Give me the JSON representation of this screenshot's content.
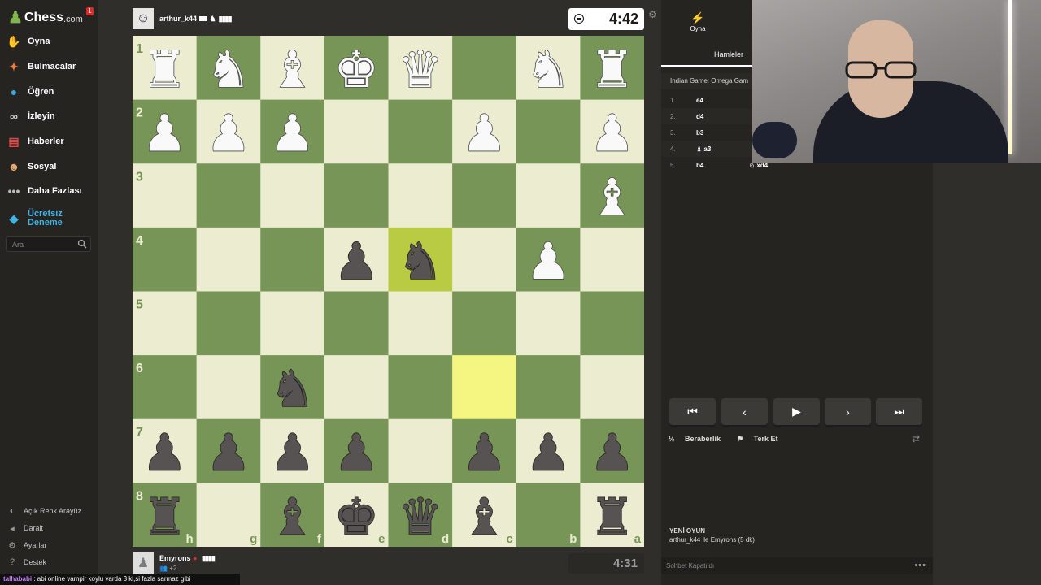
{
  "sidebar": {
    "logo_text": "Chess",
    "logo_suffix": ".com",
    "notification_count": "1",
    "items": [
      {
        "label": "Oyna",
        "icon": "play-hand-icon"
      },
      {
        "label": "Bulmacalar",
        "icon": "puzzle-icon"
      },
      {
        "label": "Öğren",
        "icon": "learn-icon"
      },
      {
        "label": "İzleyin",
        "icon": "binoculars-icon"
      },
      {
        "label": "Haberler",
        "icon": "news-icon"
      },
      {
        "label": "Sosyal",
        "icon": "social-icon"
      },
      {
        "label": "Daha Fazlası",
        "icon": "more-dots-icon"
      }
    ],
    "trial_label": "Ücretsiz Deneme",
    "search_placeholder": "Ara",
    "bottom_items": [
      {
        "label": "Açık Renk Arayüz",
        "icon": "theme-toggle-icon"
      },
      {
        "label": "Daralt",
        "icon": "collapse-icon"
      },
      {
        "label": "Ayarlar",
        "icon": "settings-icon"
      },
      {
        "label": "Destek",
        "icon": "help-icon"
      }
    ]
  },
  "top_player": {
    "name": "arthur_k44",
    "clock": "4:42",
    "bars": "▮▮▮▮"
  },
  "bottom_player": {
    "name": "Emyrons",
    "rating_note": "+2",
    "clock": "4:31",
    "bars": "▮▮▮▮"
  },
  "board": {
    "light_color": "#ebecd0",
    "dark_color": "#779556",
    "highlight_from": "#f5f682",
    "highlight_to": "#b9ca43",
    "rank_labels": [
      "1",
      "2",
      "3",
      "4",
      "5",
      "6",
      "7",
      "8"
    ],
    "file_labels": [
      "h",
      "g",
      "f",
      "e",
      "d",
      "c",
      "b",
      "a"
    ],
    "pieces": [
      [
        "wR",
        "wN",
        "wB",
        "wK",
        "wQ",
        "",
        "wN",
        "wR"
      ],
      [
        "wP",
        "wP",
        "wP",
        "",
        "",
        "wP",
        "",
        "wP"
      ],
      [
        "",
        "",
        "",
        "",
        "",
        "",
        "",
        "wB"
      ],
      [
        "",
        "",
        "",
        "bP",
        "bN",
        "",
        "wP",
        ""
      ],
      [
        "",
        "",
        "",
        "",
        "",
        "",
        "",
        ""
      ],
      [
        "",
        "",
        "bN",
        "",
        "",
        "",
        "",
        ""
      ],
      [
        "bP",
        "bP",
        "bP",
        "bP",
        "",
        "bP",
        "bP",
        "bP"
      ],
      [
        "bR",
        "",
        "bB",
        "bK",
        "bQ",
        "bB",
        "",
        "bR"
      ]
    ],
    "highlights": [
      {
        "row": 3,
        "col": 4,
        "kind": "to"
      },
      {
        "row": 5,
        "col": 5,
        "kind": "from"
      }
    ]
  },
  "panel": {
    "tab_play": "Oyna",
    "tab_moves": "Hamleler",
    "opening": "Indian Game: Omega Gam",
    "moves": [
      {
        "num": "1.",
        "white": "e4",
        "black": ""
      },
      {
        "num": "2.",
        "white": "d4",
        "black": ""
      },
      {
        "num": "3.",
        "white": "b3",
        "black": ""
      },
      {
        "num": "4.",
        "white": "♝ a3",
        "black": ""
      },
      {
        "num": "5.",
        "white": "b4",
        "black": "♘ xd4"
      }
    ],
    "draw_label": "Beraberlik",
    "resign_label": "Terk Et",
    "new_game_title": "YENİ OYUN",
    "new_game_desc": "arthur_k44 ile Emyrons (5 dk)",
    "chat_closed": "Sohbet Kapatıldı"
  },
  "chat": {
    "user": "talhababi",
    "message": " : abi online vampir koylu varda 3 ki,si fazla sarmaz gibi"
  }
}
